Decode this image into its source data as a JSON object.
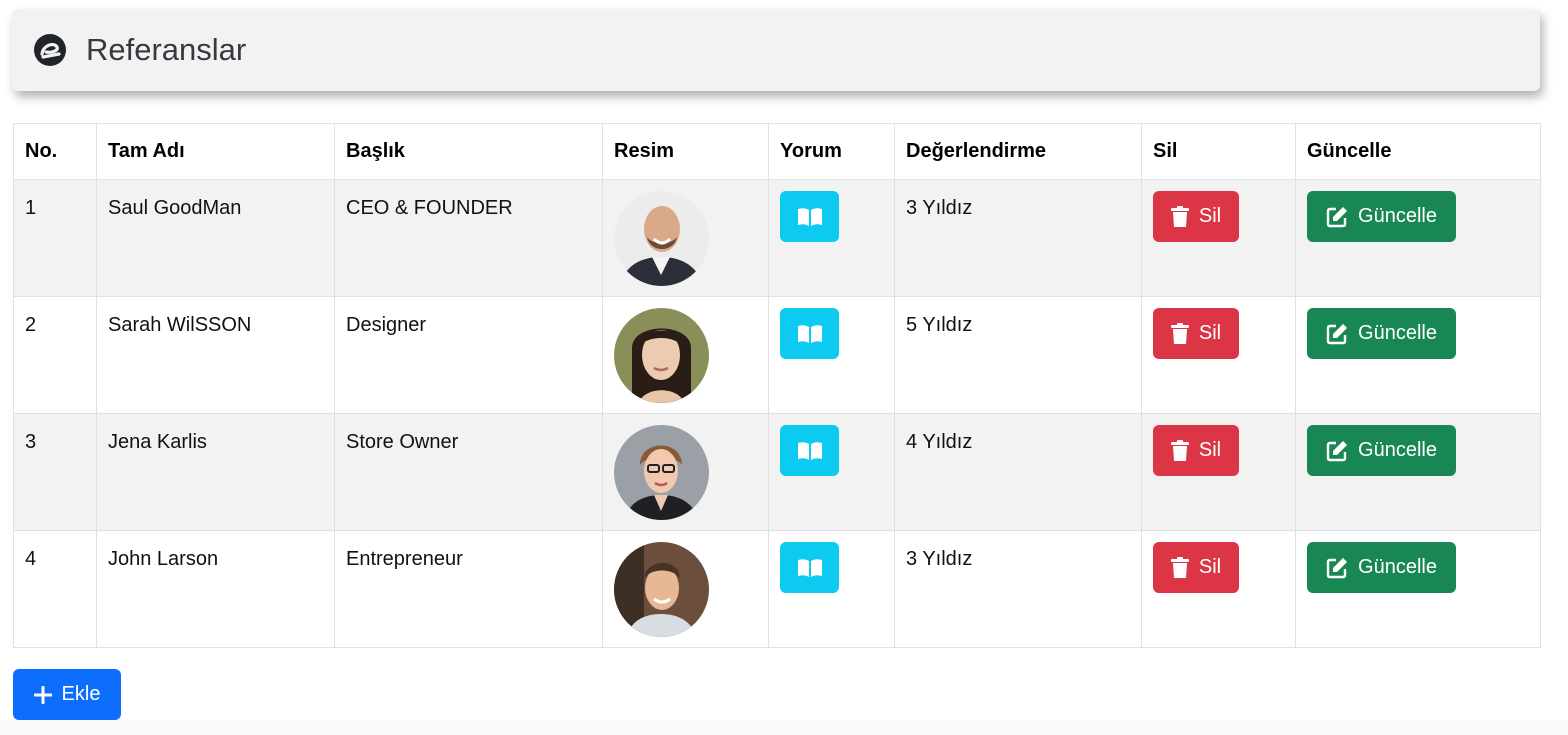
{
  "header": {
    "title": "Referanslar",
    "logo_icon": "brand-logo-icon"
  },
  "table": {
    "columns": [
      "No.",
      "Tam Adı",
      "Başlık",
      "Resim",
      "Yorum",
      "Değerlendirme",
      "Sil",
      "Güncelle"
    ],
    "rows": [
      {
        "no": "1",
        "name": "Saul GoodMan",
        "title": "CEO & FOUNDER",
        "rating": "3 Yıldız",
        "delete_label": "Sil",
        "update_label": "Güncelle"
      },
      {
        "no": "2",
        "name": "Sarah WilSSON",
        "title": "Designer",
        "rating": "5 Yıldız",
        "delete_label": "Sil",
        "update_label": "Güncelle"
      },
      {
        "no": "3",
        "name": "Jena Karlis",
        "title": "Store Owner",
        "rating": "4 Yıldız",
        "delete_label": "Sil",
        "update_label": "Güncelle"
      },
      {
        "no": "4",
        "name": "John Larson",
        "title": "Entrepreneur",
        "rating": "3 Yıldız",
        "delete_label": "Sil",
        "update_label": "Güncelle"
      }
    ]
  },
  "actions": {
    "add_label": "Ekle"
  },
  "colors": {
    "info": "#0dcaf0",
    "danger": "#dc3545",
    "success": "#198754",
    "primary": "#0d6efd"
  }
}
